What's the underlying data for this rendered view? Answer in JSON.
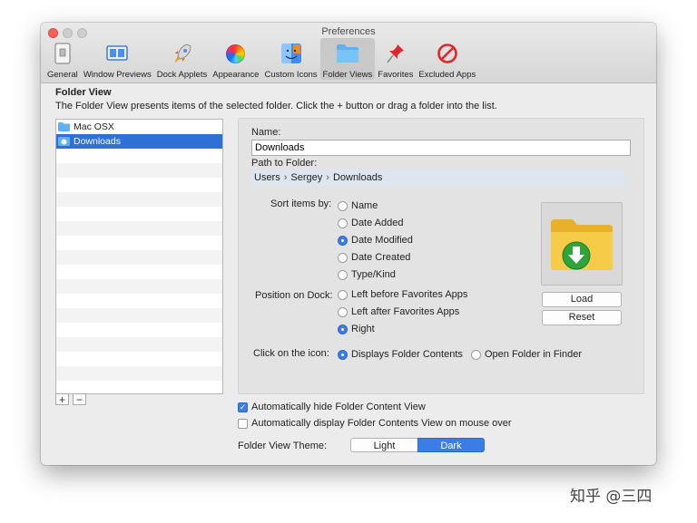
{
  "window": {
    "title": "Preferences"
  },
  "toolbar": [
    {
      "label": "General",
      "icon": "general-icon",
      "selected": false
    },
    {
      "label": "Window Previews",
      "icon": "window-previews-icon",
      "selected": false
    },
    {
      "label": "Dock Applets",
      "icon": "rocket-icon",
      "selected": false
    },
    {
      "label": "Appearance",
      "icon": "color-wheel-icon",
      "selected": false
    },
    {
      "label": "Custom Icons",
      "icon": "finder-icon",
      "selected": false
    },
    {
      "label": "Folder Views",
      "icon": "folder-icon",
      "selected": true
    },
    {
      "label": "Favorites",
      "icon": "pin-icon",
      "selected": false
    },
    {
      "label": "Excluded Apps",
      "icon": "no-entry-icon",
      "selected": false
    }
  ],
  "section": {
    "title": "Folder View",
    "description": "The Folder View presents items of the selected folder. Click the + button or drag a folder into the list."
  },
  "folders": [
    {
      "name": "Mac OSX",
      "selected": false
    },
    {
      "name": "Downloads",
      "selected": true
    }
  ],
  "list_buttons": {
    "add": "+",
    "remove": "−"
  },
  "detail": {
    "name_label": "Name:",
    "name_value": "Downloads",
    "path_label": "Path to Folder:",
    "path": [
      "Users",
      "Sergey",
      "Downloads"
    ],
    "path_separator": "›",
    "sort_label": "Sort items by:",
    "sort_options": [
      {
        "label": "Name",
        "checked": false
      },
      {
        "label": "Date Added",
        "checked": false
      },
      {
        "label": "Date Modified",
        "checked": true
      },
      {
        "label": "Date Created",
        "checked": false
      },
      {
        "label": "Type/Kind",
        "checked": false
      }
    ],
    "position_label": "Position on Dock:",
    "position_options": [
      {
        "label": "Left before Favorites Apps",
        "checked": false
      },
      {
        "label": "Left after Favorites Apps",
        "checked": false
      },
      {
        "label": "Right",
        "checked": true
      }
    ],
    "click_label": "Click on the icon:",
    "click_options": [
      {
        "label": "Displays Folder Contents",
        "checked": true
      },
      {
        "label": "Open Folder in Finder",
        "checked": false
      }
    ],
    "load_button": "Load",
    "reset_button": "Reset"
  },
  "options": {
    "auto_hide": {
      "label": "Automatically hide Folder Content View",
      "checked": true
    },
    "auto_display": {
      "label": "Automatically display Folder Contents View on mouse over",
      "checked": false
    }
  },
  "theme": {
    "label": "Folder View Theme:",
    "options": [
      "Light",
      "Dark"
    ],
    "selected": "Dark"
  },
  "colors": {
    "accent": "#3a7de6",
    "selection": "#2e6fd8",
    "close": "#fc5f57"
  },
  "watermark": "知乎 @三四"
}
